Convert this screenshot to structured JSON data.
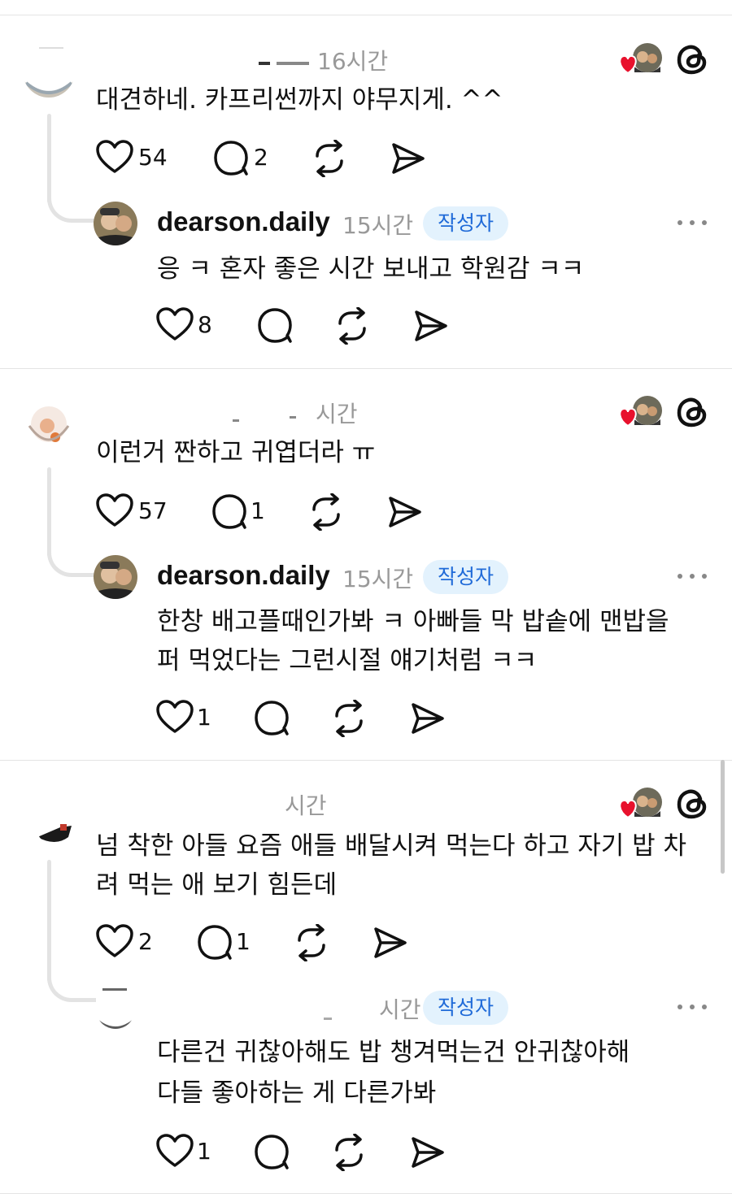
{
  "comments": [
    {
      "time": "16시간",
      "text": "대견하네. 카프리썬까지 야무지게. ^^",
      "likes": "54",
      "replies": "2",
      "reply": {
        "username": "dearson.daily",
        "time": "15시간",
        "badge": "작성자",
        "text": [
          "응 ㅋ 혼자 좋은 시간 보내고 학원감 ㅋㅋ"
        ],
        "likes": "8"
      }
    },
    {
      "time": "시간",
      "text": "이런거 짠하고 귀엽더라 ㅠ",
      "likes": "57",
      "replies": "1",
      "reply": {
        "username": "dearson.daily",
        "time": "15시간",
        "badge": "작성자",
        "text": [
          "한창 배고플때인가봐 ㅋ 아빠들 막 밥솥에 맨밥을",
          "퍼 먹었다는 그런시절 얘기처럼 ㅋㅋ"
        ],
        "likes": "1"
      }
    },
    {
      "time": "시간",
      "text": [
        "넘 착한 아들 요즘 애들 배달시켜 먹는다 하고 자기 밥 차",
        "려 먹는 애 보기 힘든데"
      ],
      "likes": "2",
      "replies": "1",
      "reply": {
        "username": "",
        "time": "시간",
        "badge": "작성자",
        "text": [
          "다른건 귀찮아해도 밥 챙겨먹는건 안귀찮아해",
          "다들 좋아하는 게 다른가봐"
        ],
        "likes": "1"
      }
    }
  ],
  "icons": {
    "like": "heart-icon",
    "reply": "comment-icon",
    "repost": "repost-icon",
    "share": "send-icon",
    "more": "more-icon",
    "brand": "threads-logo-icon",
    "liked_by_author": "liked-heart-icon"
  },
  "colors": {
    "badge_bg": "#e3f2fd",
    "badge_text": "#1f6ad8",
    "heart": "#e8112d",
    "muted": "#999999"
  }
}
